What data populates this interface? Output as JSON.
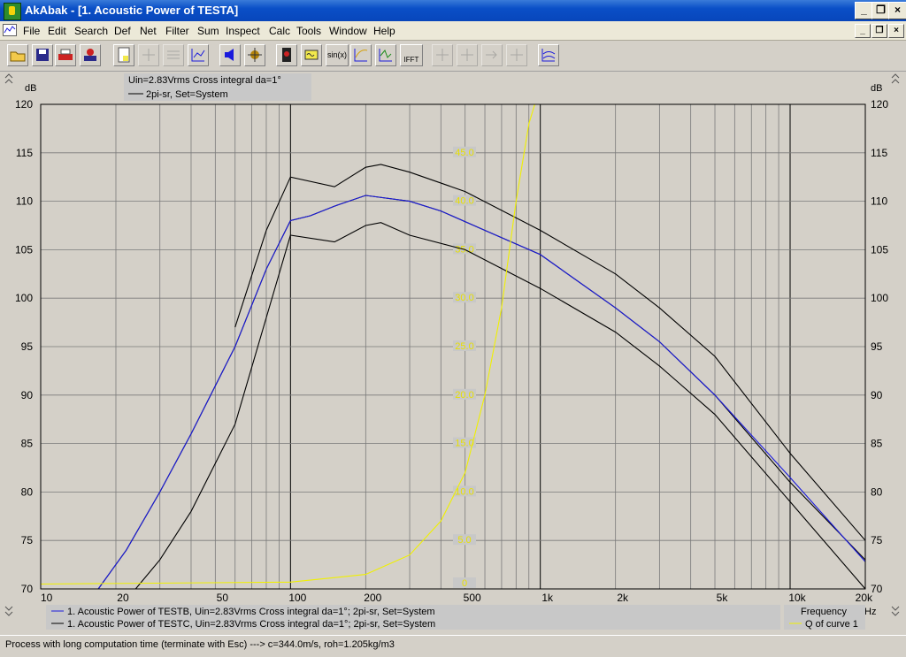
{
  "window": {
    "title": "AkAbak - [1. Acoustic Power of TESTA]"
  },
  "menu": [
    "File",
    "Edit",
    "Search",
    "Def",
    "Net",
    "Filter",
    "Sum",
    "Inspect",
    "Calc",
    "Tools",
    "Window",
    "Help"
  ],
  "toolbar": {
    "sin_label": "sin(x)",
    "ifft_label": "IFFT"
  },
  "chart_data": {
    "type": "line",
    "yunit": "dB",
    "ylim": [
      70,
      120
    ],
    "xscale": "log",
    "xlim": [
      10,
      20000
    ],
    "grid": true,
    "yticks": [
      70,
      75,
      80,
      85,
      90,
      95,
      100,
      105,
      110,
      115,
      120
    ],
    "xticks": [
      {
        "v": 10,
        "label": "10"
      },
      {
        "v": 20,
        "label": "20"
      },
      {
        "v": 50,
        "label": "50"
      },
      {
        "v": 100,
        "label": "100"
      },
      {
        "v": 200,
        "label": "200"
      },
      {
        "v": 500,
        "label": "500"
      },
      {
        "v": 1000,
        "label": "1k"
      },
      {
        "v": 2000,
        "label": "2k"
      },
      {
        "v": 5000,
        "label": "5k"
      },
      {
        "v": 10000,
        "label": "10k"
      },
      {
        "v": 20000,
        "label": "20k"
      }
    ],
    "xunit": "Hz",
    "xlabel": "Frequency",
    "q_scale_labels": [
      "0",
      "5.0",
      "10.0",
      "15.0",
      "20.0",
      "25.0",
      "30.0",
      "35.0",
      "40.0",
      "45.0"
    ],
    "header_legend": [
      "Uin=2.83Vrms Cross integral da=1°",
      "2pi-sr, Set=System"
    ],
    "legend_entries": [
      "1. Acoustic Power of TESTB, Uin=2.83Vrms Cross integral da=1°; 2pi-sr, Set=System",
      "1. Acoustic Power of TESTC, Uin=2.83Vrms Cross integral da=1°; 2pi-sr, Set=System"
    ],
    "q_legend": "Q of curve 1",
    "series": [
      {
        "color": "#000000",
        "points": [
          [
            17,
            70
          ],
          [
            22,
            74
          ],
          [
            30,
            80
          ],
          [
            40,
            86
          ],
          [
            60,
            95
          ],
          [
            80,
            103
          ],
          [
            100,
            108
          ],
          [
            120,
            108.5
          ],
          [
            150,
            109.5
          ],
          [
            200,
            110.6
          ],
          [
            300,
            110
          ],
          [
            400,
            109
          ],
          [
            600,
            107
          ],
          [
            1000,
            104.5
          ],
          [
            2000,
            99
          ],
          [
            3000,
            95.5
          ],
          [
            5000,
            90
          ],
          [
            10000,
            81
          ],
          [
            20000,
            73
          ]
        ]
      },
      {
        "color": "#1a1adc",
        "points": [
          [
            17,
            70
          ],
          [
            22,
            74
          ],
          [
            30,
            80
          ],
          [
            40,
            86
          ],
          [
            60,
            95
          ],
          [
            80,
            103
          ],
          [
            100,
            108
          ],
          [
            120,
            108.5
          ],
          [
            150,
            109.5
          ],
          [
            200,
            110.6
          ],
          [
            300,
            110
          ],
          [
            400,
            109
          ],
          [
            600,
            107
          ],
          [
            1000,
            104.5
          ],
          [
            2000,
            99
          ],
          [
            3000,
            95.5
          ],
          [
            5000,
            90
          ],
          [
            10000,
            81.5
          ],
          [
            20000,
            72.8
          ]
        ]
      },
      {
        "color": "#000000",
        "points": [
          [
            24,
            70
          ],
          [
            30,
            73
          ],
          [
            40,
            78
          ],
          [
            60,
            87
          ],
          [
            80,
            98
          ],
          [
            100,
            106.5
          ],
          [
            150,
            105.8
          ],
          [
            200,
            107.5
          ],
          [
            230,
            107.8
          ],
          [
            300,
            106.5
          ],
          [
            500,
            105
          ],
          [
            1000,
            101
          ],
          [
            2000,
            96.5
          ],
          [
            3000,
            93
          ],
          [
            5000,
            88
          ],
          [
            10000,
            79
          ],
          [
            20000,
            70
          ]
        ]
      },
      {
        "color": "#000000",
        "points": [
          [
            60,
            97
          ],
          [
            80,
            107
          ],
          [
            100,
            112.5
          ],
          [
            150,
            111.5
          ],
          [
            200,
            113.5
          ],
          [
            230,
            113.8
          ],
          [
            300,
            113
          ],
          [
            500,
            111
          ],
          [
            1000,
            107
          ],
          [
            2000,
            102.5
          ],
          [
            3000,
            99
          ],
          [
            5000,
            94
          ],
          [
            10000,
            84
          ],
          [
            20000,
            75
          ]
        ]
      },
      {
        "color": "#f0f000",
        "points": [
          [
            10,
            70.5
          ],
          [
            100,
            70.7
          ],
          [
            200,
            71.5
          ],
          [
            300,
            73.5
          ],
          [
            400,
            77
          ],
          [
            500,
            82
          ],
          [
            600,
            90
          ],
          [
            700,
            99
          ],
          [
            800,
            110
          ],
          [
            900,
            118
          ],
          [
            950,
            120
          ],
          [
            20000,
            120
          ]
        ]
      }
    ]
  },
  "status": {
    "text": "Process with long computation time (terminate with Esc) ---> c=344.0m/s, roh=1.205kg/m3"
  }
}
